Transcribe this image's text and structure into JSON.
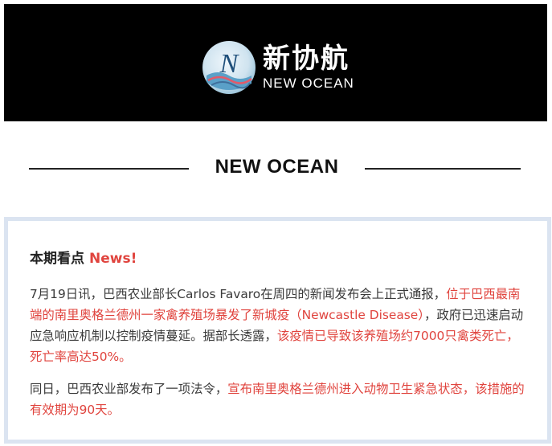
{
  "header": {
    "logo_cn": "新协航",
    "logo_en": "NEW OCEAN",
    "logo_mark": "N"
  },
  "section_title": "NEW OCEAN",
  "card": {
    "heading": "本期看点",
    "heading_accent": "News!",
    "para1": [
      {
        "text": "7月19日讯，巴西农业部长Carlos Favaro在周四的新闻发布会上正式通报，",
        "highlight": false
      },
      {
        "text": "位于巴西最南端的南里奥格兰德州一家禽养殖场暴发了新城疫（Newcastle Disease）",
        "highlight": true
      },
      {
        "text": "，政府已迅速启动应急响应机制以控制疫情蔓延。据部长透露，",
        "highlight": false
      },
      {
        "text": "该疫情已导致该养殖场约7000只禽类死亡，死亡率高达50%。",
        "highlight": true
      }
    ],
    "para2": [
      {
        "text": "同日，巴西农业部发布了一项法令，",
        "highlight": false
      },
      {
        "text": "宣布南里奥格兰德州进入动物卫生紧急状态，该措施的有效期为90天。",
        "highlight": true
      }
    ]
  },
  "colors": {
    "accent": "#e0443e",
    "banner_bg": "#000000",
    "card_border": "#dbe4f1",
    "body_text": "#3a3a3a"
  }
}
